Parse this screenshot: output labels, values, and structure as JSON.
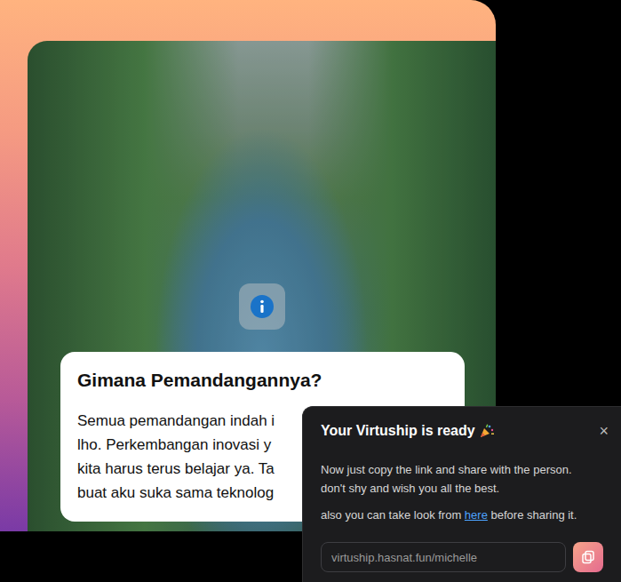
{
  "card": {
    "title": "Gimana Pemandangannya?",
    "lines": [
      "Semua pemandangan indah i",
      "lho. Perkembangan inovasi y",
      "kita harus terus belajar ya. Ta",
      "buat aku suka sama teknolog"
    ]
  },
  "popup": {
    "title": "Your Virtuship is ready",
    "close": "×",
    "lines": [
      "Now just copy the link and share with the person.",
      "don't shy and wish you all the best."
    ],
    "note_before": "also you can take look from ",
    "note_link": "here",
    "note_after": " before sharing it.",
    "link": "virtuship.hasnat.fun/michelle"
  }
}
